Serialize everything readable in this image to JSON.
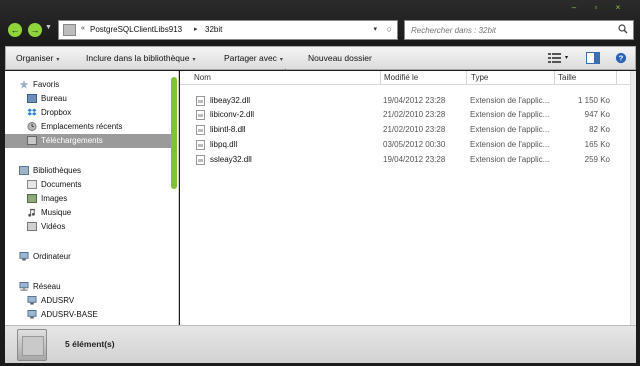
{
  "window": {
    "controls": {
      "minimize": "–",
      "maximize": "▫",
      "close": "×"
    }
  },
  "nav": {
    "back": "←",
    "forward": "→",
    "history": "▼"
  },
  "address": {
    "prefix": "«",
    "segments": [
      "PostgreSQLClientLibs913",
      "32bit"
    ],
    "separator": "▸",
    "dropdown": "▾",
    "refresh": "○"
  },
  "search": {
    "placeholder": "Rechercher dans : 32bit",
    "icon": "search-icon"
  },
  "toolbar": {
    "organize": "Organiser",
    "include": "Inclure dans la bibliothèque",
    "share": "Partager avec",
    "new_folder": "Nouveau dossier",
    "chevron": "▾",
    "views_chevron": "▾"
  },
  "sidebar": {
    "favorites": {
      "title": "Favoris",
      "items": [
        "Bureau",
        "Dropbox",
        "Emplacements récents",
        "Téléchargements"
      ]
    },
    "libraries": {
      "title": "Bibliothèques",
      "items": [
        "Documents",
        "Images",
        "Musique",
        "Vidéos"
      ]
    },
    "computer": {
      "title": "Ordinateur"
    },
    "network": {
      "title": "Réseau",
      "items": [
        "ADUSRV",
        "ADUSRV-BASE"
      ]
    },
    "selected": "Téléchargements"
  },
  "columns": {
    "name": "Nom",
    "modified": "Modifié le",
    "type": "Type",
    "size": "Taille",
    "sort_indicator": "^"
  },
  "files": [
    {
      "name": "libeay32.dll",
      "modified": "19/04/2012 23:28",
      "type": "Extension de l'applic...",
      "size": "1 150 Ko"
    },
    {
      "name": "libiconv-2.dll",
      "modified": "21/02/2010 23:28",
      "type": "Extension de l'applic...",
      "size": "947 Ko"
    },
    {
      "name": "libintl-8.dll",
      "modified": "21/02/2010 23:28",
      "type": "Extension de l'applic...",
      "size": "82 Ko"
    },
    {
      "name": "libpq.dll",
      "modified": "03/05/2012 00:30",
      "type": "Extension de l'applic...",
      "size": "165 Ko"
    },
    {
      "name": "ssleay32.dll",
      "modified": "19/04/2012 23:28",
      "type": "Extension de l'applic...",
      "size": "259 Ko"
    }
  ],
  "details": {
    "count": "5 élément(s)"
  },
  "colors": {
    "accent": "#8ed43a",
    "chrome_dark": "#1b1b1b",
    "selected_bg": "#9a9a9a"
  }
}
